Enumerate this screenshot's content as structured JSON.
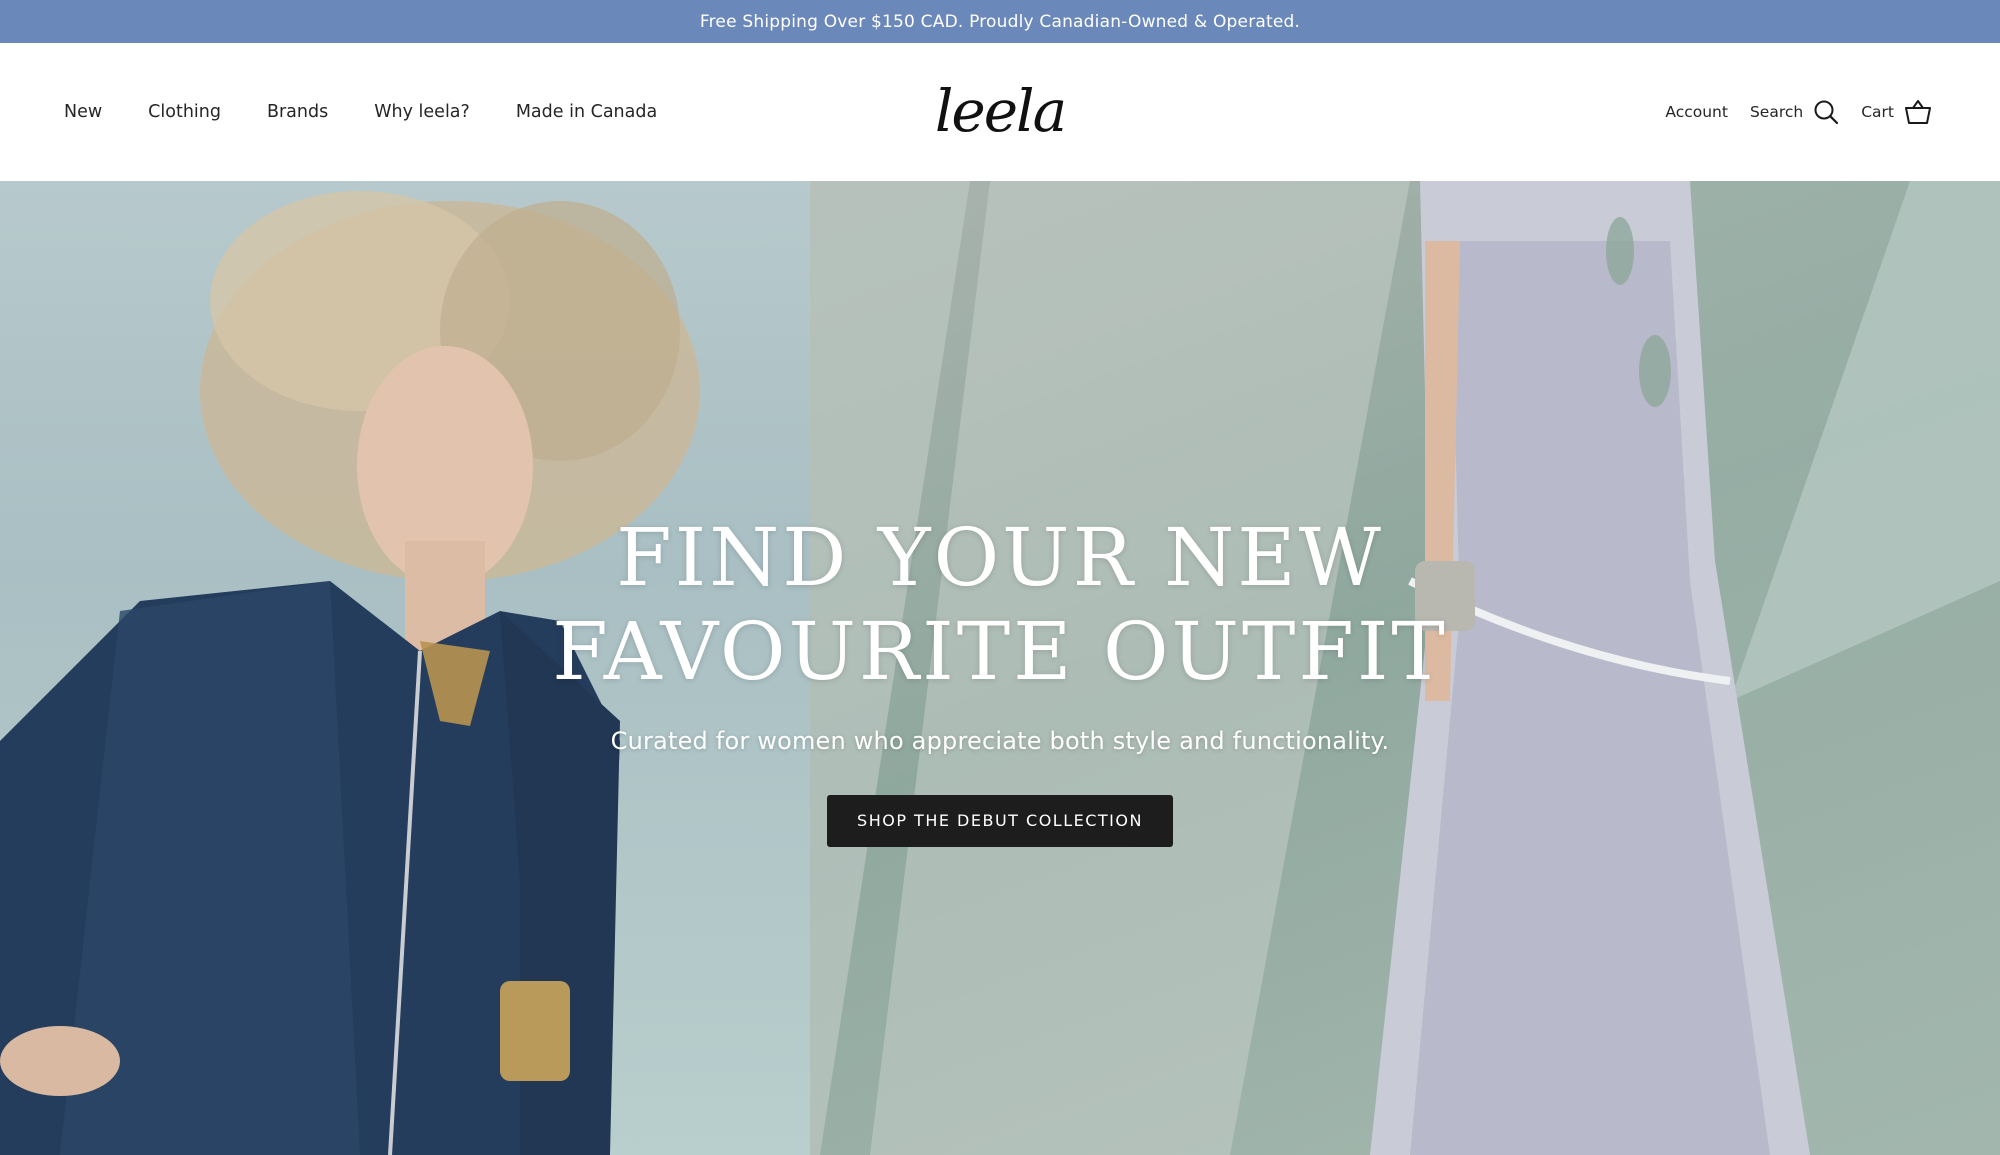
{
  "announcement": {
    "text": "Free Shipping Over $150 CAD. Proudly Canadian-Owned & Operated.",
    "bg_color": "#6b88bb"
  },
  "header": {
    "nav": [
      {
        "label": "New"
      },
      {
        "label": "Clothing"
      },
      {
        "label": "Brands"
      },
      {
        "label": "Why leela?"
      },
      {
        "label": "Made in Canada"
      }
    ],
    "logo": "leela",
    "utility": {
      "account_label": "Account",
      "search_label": "Search",
      "cart_label": "Cart",
      "search_icon": "search-icon",
      "cart_icon": "basket-icon"
    }
  },
  "hero": {
    "title_line1": "FIND YOUR NEW",
    "title_line2": "FAVOURITE OUTFIT",
    "subtitle": "Curated for women who appreciate both style and functionality.",
    "cta_label": "SHOP THE DEBUT COLLECTION",
    "cta_color": "#1d1d1d",
    "left_image": "woman-in-navy-perforated-jacket",
    "right_image": "model-in-patterned-dress"
  }
}
